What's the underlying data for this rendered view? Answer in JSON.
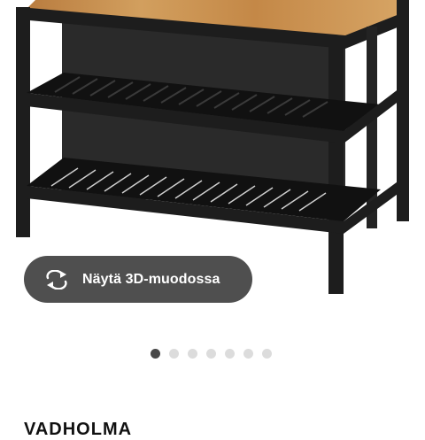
{
  "product": {
    "name": "VADHOLMA",
    "image_alt": "Kitchen island with oak worktop and black frame with slatted shelves"
  },
  "view_3d": {
    "label": "Näytä 3D-muodossa",
    "icon": "rotate-arrows-icon"
  },
  "carousel": {
    "total": 7,
    "active_index": 0
  },
  "colors": {
    "button_bg": "#4f4f4f",
    "frame": "#1d1d1d",
    "wood": "#c8914e",
    "dot_active": "#484848",
    "dot_inactive": "#dcdcdc"
  }
}
